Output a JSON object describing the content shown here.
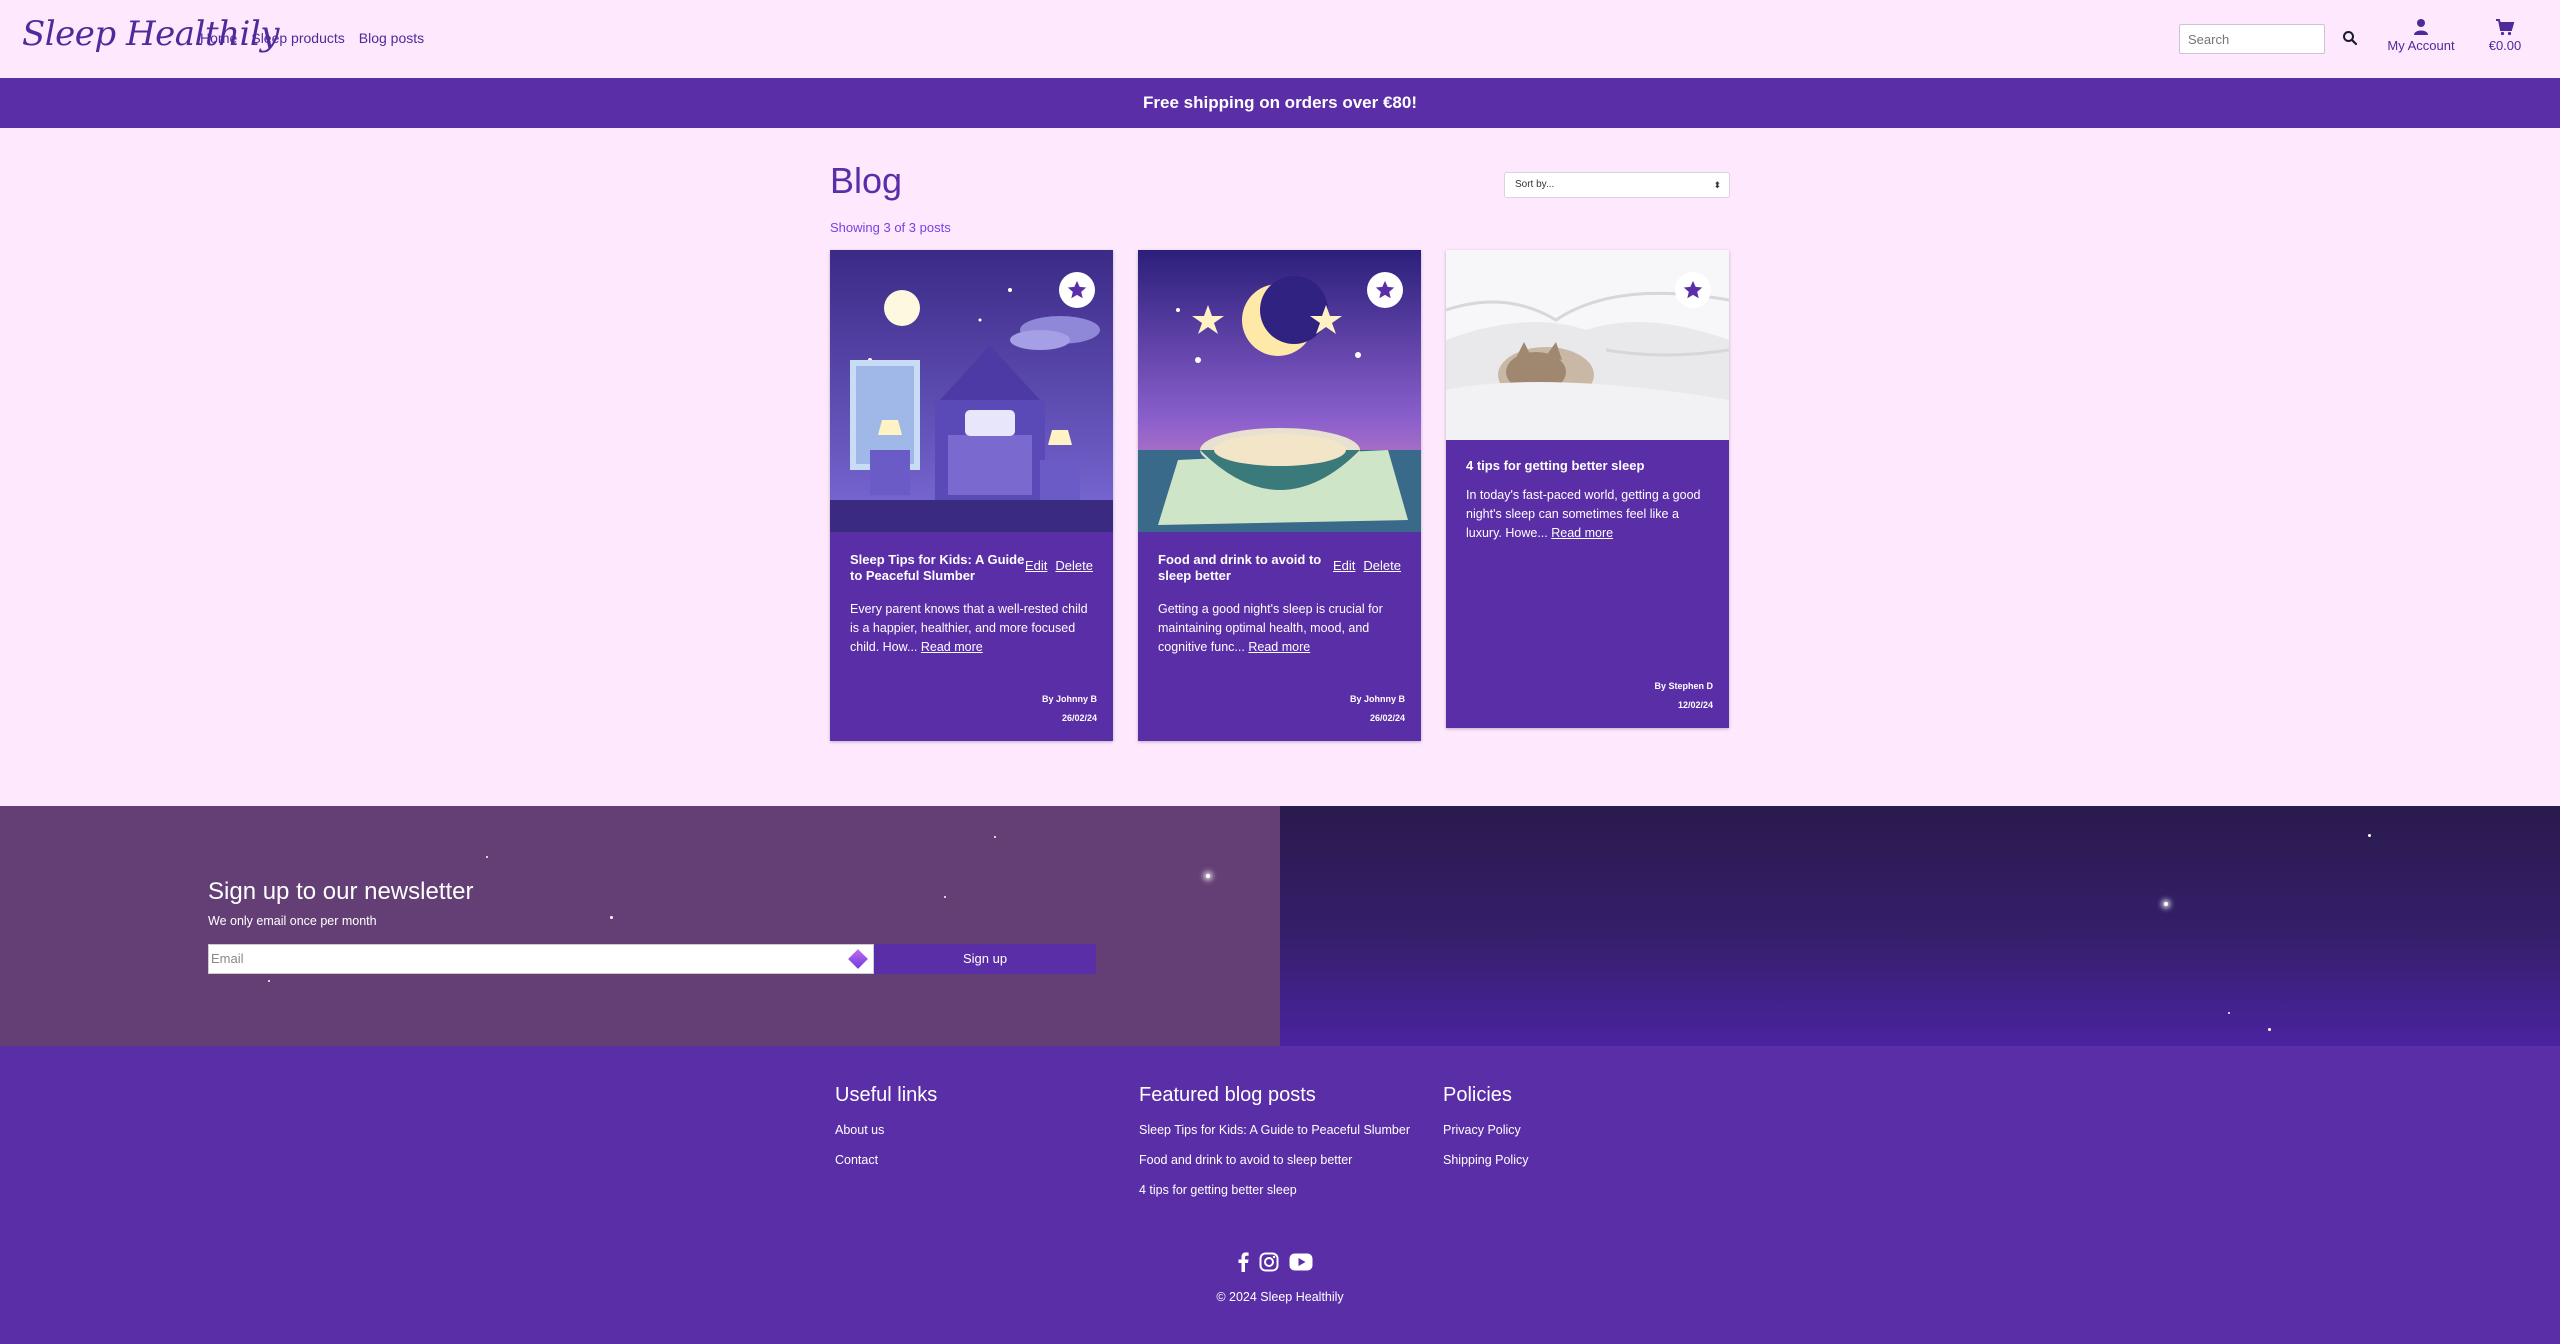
{
  "header": {
    "logo": "Sleep Healthily",
    "nav": [
      "Home",
      "Sleep products",
      "Blog posts"
    ],
    "search_placeholder": "Search",
    "account_label": "My Account",
    "cart_total": "€0.00"
  },
  "banner": {
    "text": "Free shipping on orders over €80!"
  },
  "blog": {
    "title": "Blog",
    "showing": "Showing 3 of 3 posts",
    "sort_label": "Sort by...",
    "posts": [
      {
        "title": "Sleep Tips for Kids: A Guide to Peaceful Slumber",
        "edit": "Edit",
        "delete": "Delete",
        "excerpt": "Every parent knows that a well-rested child is a happier, healthier, and more focused child. How...",
        "read_more": "Read more",
        "author": "By Johnny B",
        "date": "26/02/24"
      },
      {
        "title": "Food and drink to avoid to sleep better",
        "edit": "Edit",
        "delete": "Delete",
        "excerpt": "Getting a good night's sleep is crucial for maintaining optimal health, mood, and cognitive func...",
        "read_more": "Read more",
        "author": "By Johnny B",
        "date": "26/02/24"
      },
      {
        "title": "4 tips for getting better sleep",
        "excerpt": "In today's fast-paced world, getting a good night's sleep can sometimes feel like a luxury. Howe...",
        "read_more": "Read more",
        "author": "By Stephen D",
        "date": "12/02/24"
      }
    ]
  },
  "newsletter": {
    "title": "Sign up to our newsletter",
    "subtitle": "We only email once per month",
    "email_placeholder": "Email",
    "button": "Sign up"
  },
  "footer": {
    "useful_links": {
      "title": "Useful links",
      "items": [
        "About us",
        "Contact"
      ]
    },
    "featured": {
      "title": "Featured blog posts",
      "items": [
        "Sleep Tips for Kids: A Guide to Peaceful Slumber",
        "Food and drink to avoid to sleep better",
        "4 tips for getting better sleep"
      ]
    },
    "policies": {
      "title": "Policies",
      "items": [
        "Privacy Policy",
        "Shipping Policy"
      ]
    },
    "social_icons": [
      "facebook-icon",
      "instagram-icon",
      "youtube-icon"
    ],
    "copyright": "© 2024 Sleep Healthily"
  },
  "colors": {
    "brand": "#5a2ea6",
    "page_bg": "#fde8fd",
    "newsletter_bg": "#643f76"
  }
}
